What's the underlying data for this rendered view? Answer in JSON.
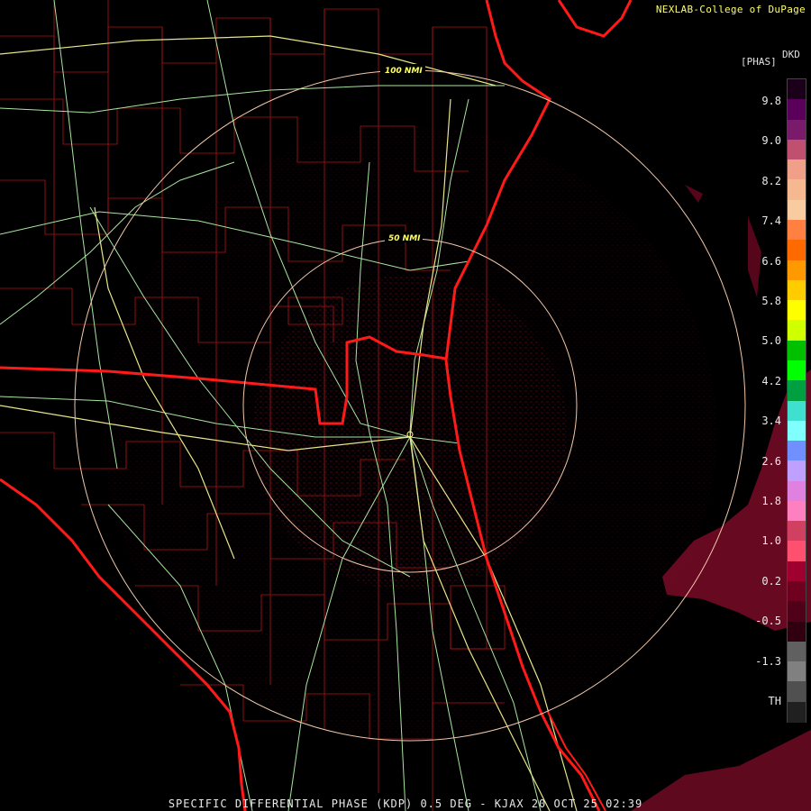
{
  "credit": "NEXLAB-College of DuPage",
  "footer": "SPECIFIC DIFFERENTIAL PHASE (KDP) 0.5 DEG - KJAX 20 OCT 25 02:39",
  "legend": {
    "product": "DKD",
    "unit": "[PHAS]",
    "ticks": [
      "9.8",
      "9.0",
      "8.2",
      "7.4",
      "6.6",
      "5.8",
      "5.0",
      "4.2",
      "3.4",
      "2.6",
      "1.8",
      "1.0",
      "0.2",
      "-0.5",
      "-1.3",
      "TH"
    ],
    "colors": [
      "#1a0018",
      "#5a005a",
      "#7a1a6a",
      "#c05070",
      "#f0a088",
      "#f5b890",
      "#f9cba0",
      "#ff8040",
      "#ff6a00",
      "#ff9900",
      "#ffcc00",
      "#ffff00",
      "#d0ff00",
      "#00c000",
      "#00ff00",
      "#00a040",
      "#40e0d0",
      "#80ffff",
      "#7090ff",
      "#c0a0ff",
      "#e080e0",
      "#ff80c0",
      "#d04060",
      "#ff5070",
      "#a00030",
      "#700020",
      "#500018",
      "#300010",
      "#606060",
      "#808080",
      "#505050",
      "#202020"
    ]
  },
  "map": {
    "range_rings": [
      {
        "label": "100 NMI"
      },
      {
        "label": "50 NMI"
      }
    ]
  },
  "colors": {
    "coast": "#ff1a1a",
    "counties": "#b01515",
    "roads": "#a8e6a0",
    "highways": "#e6e68a",
    "ring": "#f2c8a8",
    "echo": "#8a0a2a"
  }
}
